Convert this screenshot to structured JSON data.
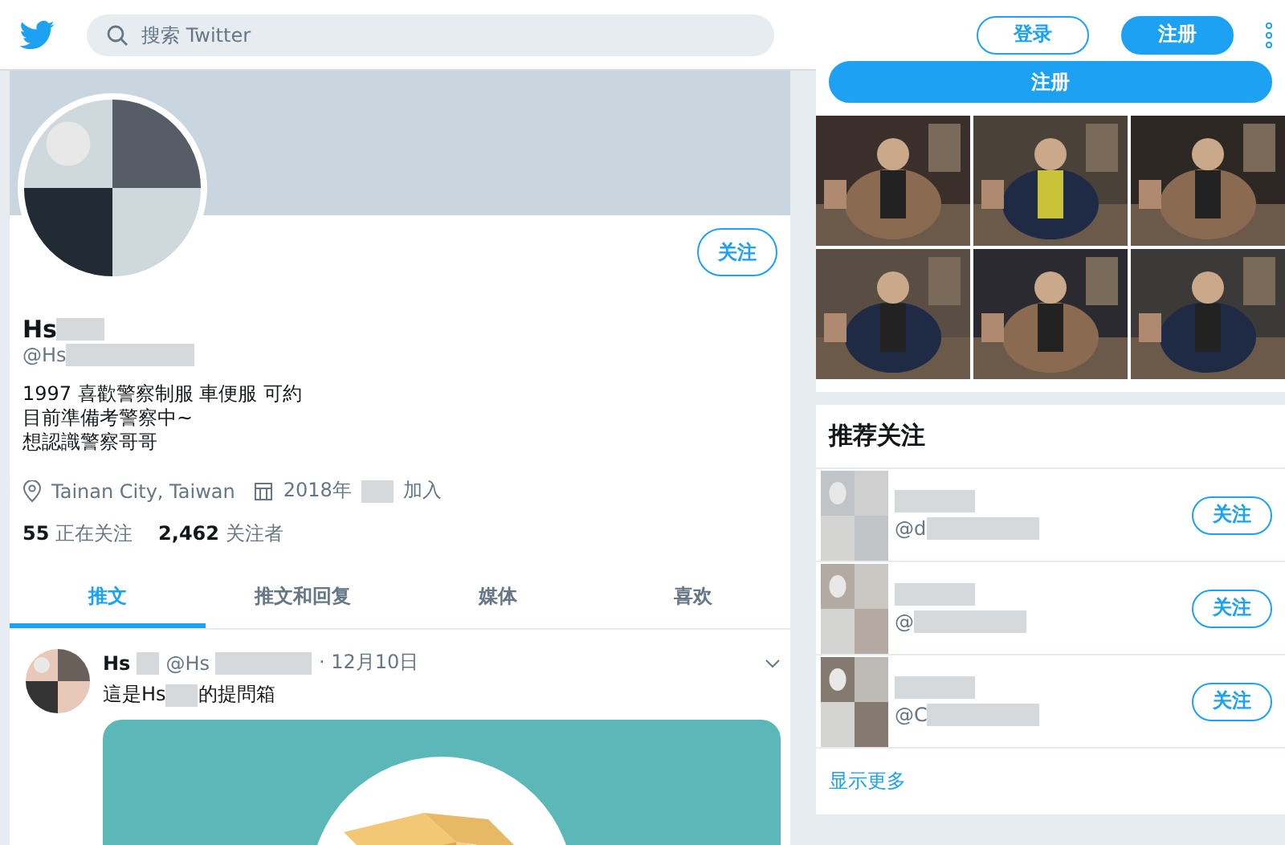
{
  "header": {
    "search_placeholder": "搜索 Twitter",
    "login": "登录",
    "signup": "注册"
  },
  "profile": {
    "follow": "关注",
    "name": "Hs",
    "handle": "@Hs",
    "bio": [
      "1997 喜歡警察制服 車便服 可約",
      "目前準備考警察中~",
      "想認識警察哥哥"
    ],
    "location": "Tainan City, Taiwan",
    "joined_prefix": "2018年",
    "joined_suffix": "加入",
    "following_count": "55",
    "following_label": "正在关注",
    "followers_count": "2,462",
    "followers_label": "关注者"
  },
  "tabs": [
    {
      "label": "推文",
      "selected": true
    },
    {
      "label": "推文和回复",
      "selected": false
    },
    {
      "label": "媒体",
      "selected": false
    },
    {
      "label": "喜欢",
      "selected": false
    }
  ],
  "tweet": {
    "name": "Hs",
    "handle": "@Hs",
    "date": "· 12月10日",
    "text_prefix": "這是Hs",
    "text_suffix": "的提問箱"
  },
  "sidebar": {
    "signup": "注册",
    "suggest_title": "推荐关注",
    "suggestions": [
      {
        "handle": "@d",
        "follow": "关注"
      },
      {
        "handle": "@",
        "follow": "关注"
      },
      {
        "handle": "@C",
        "follow": "关注"
      }
    ],
    "show_more": "显示更多"
  }
}
